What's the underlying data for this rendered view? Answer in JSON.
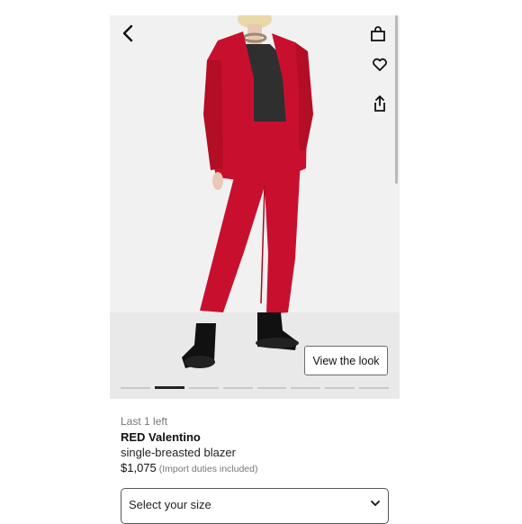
{
  "gallery": {
    "view_look_label": "View the look",
    "slide_count": 8,
    "active_slide": 2
  },
  "product": {
    "availability": "Last 1 left",
    "brand": "RED Valentino",
    "name": "single-breasted blazer",
    "price": "$1,075",
    "duties_note": "(Import duties included)"
  },
  "size_selector": {
    "placeholder": "Select your size"
  },
  "icons": {
    "back": "back-arrow-icon",
    "bag": "shopping-bag-icon",
    "wishlist": "heart-icon",
    "share": "share-icon"
  },
  "colors": {
    "suit": "#c8102e",
    "background": "#f1f1f1",
    "text_muted": "#777777"
  }
}
